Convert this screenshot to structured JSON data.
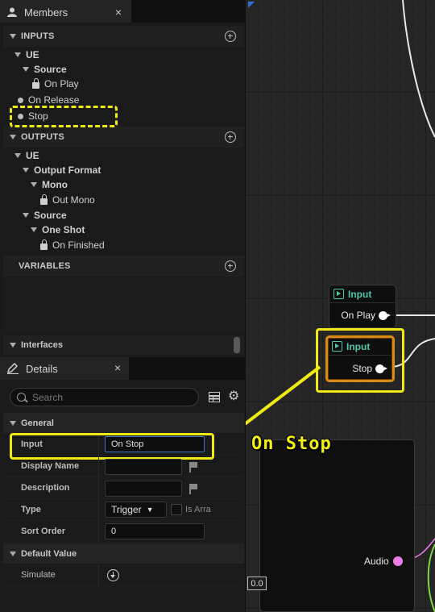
{
  "members_panel": {
    "tab_label": "Members",
    "close_glyph": "×",
    "sections": {
      "inputs": "INPUTS",
      "outputs": "OUTPUTS",
      "variables": "VARIABLES"
    },
    "inputs_tree": [
      {
        "label": "UE",
        "bold": true
      },
      {
        "label": "Source",
        "bold": true
      },
      {
        "label": "On Play",
        "locked": true
      },
      {
        "label": "On Release",
        "dot": true
      },
      {
        "label": "Stop",
        "dot": true
      }
    ],
    "outputs_tree": [
      {
        "label": "UE",
        "bold": true
      },
      {
        "label": "Output Format",
        "bold": true
      },
      {
        "label": "Mono",
        "bold": true
      },
      {
        "label": "Out Mono",
        "locked": true
      },
      {
        "label": "Source",
        "bold": true
      },
      {
        "label": "One Shot",
        "bold": true
      },
      {
        "label": "On Finished",
        "locked": true
      }
    ],
    "interfaces_label": "Interfaces"
  },
  "details_panel": {
    "tab_label": "Details",
    "close_glyph": "×",
    "search_placeholder": "Search",
    "general_section": "General",
    "default_value_section": "Default Value",
    "properties": {
      "input_label": "Input",
      "input_value": "On Stop",
      "display_name_label": "Display Name",
      "display_name_value": "",
      "description_label": "Description",
      "description_value": "",
      "type_label": "Type",
      "type_value": "Trigger",
      "is_array_label": "Is Arra",
      "sort_order_label": "Sort Order",
      "sort_order_value": "0",
      "simulate_label": "Simulate"
    }
  },
  "graph": {
    "node1": {
      "title": "Input",
      "pin": "On Play"
    },
    "node2": {
      "title": "Input",
      "pin": "Stop"
    },
    "audio_pin": "Audio",
    "zoom_readout": "0.0",
    "callout_text": "On Stop"
  },
  "colors": {
    "highlight": "#f0ea14",
    "node_title": "#52c6a8",
    "selected_node_border": "#d88a17",
    "audio_pin": "#ea7ee6",
    "wire_green": "#7fd84a"
  }
}
